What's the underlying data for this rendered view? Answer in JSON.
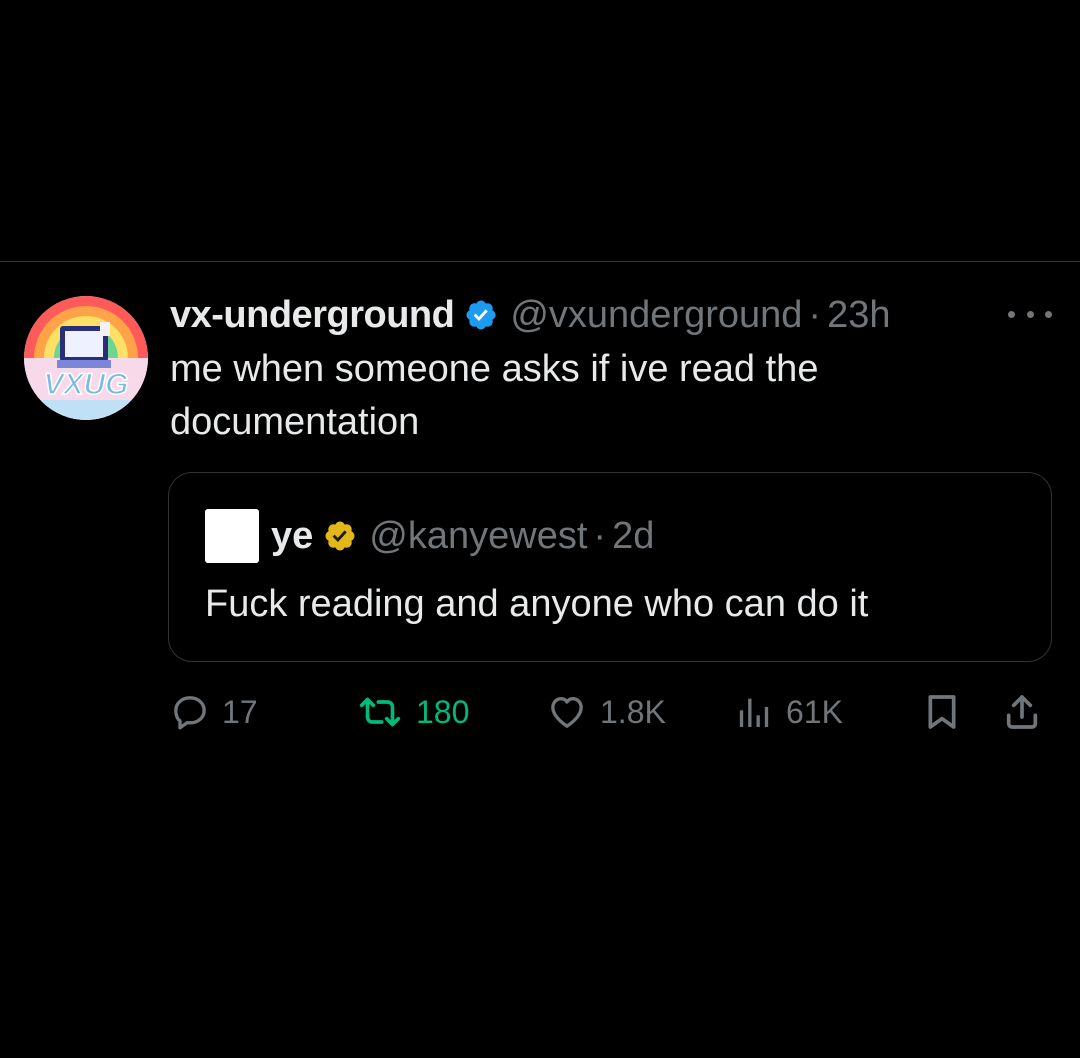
{
  "tweet": {
    "author": {
      "display_name": "vx-underground",
      "handle": "@vxunderground",
      "verified": "blue-verified",
      "avatar_text": "VXUG"
    },
    "separator": "·",
    "time": "23h",
    "text": "me when someone asks if ive read the documentation",
    "more_icon": "more-horizontal-icon"
  },
  "quote": {
    "author": {
      "display_name": "ye",
      "handle": "@kanyewest",
      "verified": "gold-verified"
    },
    "separator": "·",
    "time": "2d",
    "text": "Fuck reading and anyone who can do it"
  },
  "actions": {
    "replies": "17",
    "retweets": "180",
    "likes": "1.8K",
    "views": "61K",
    "bookmark_icon": "bookmark-icon",
    "share_icon": "share-icon"
  },
  "colors": {
    "background": "#000000",
    "text": "#e7e9ea",
    "muted": "#71767b",
    "divider": "#2f3336",
    "retweet_active": "#00ba7c",
    "verified_blue": "#1d9bf0",
    "verified_gold": "#e2b719"
  }
}
